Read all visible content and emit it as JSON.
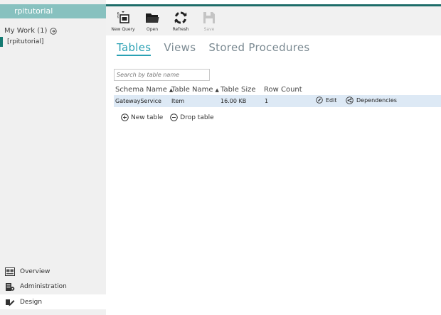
{
  "sidebar": {
    "header": "rpitutorial",
    "my_work_label": "My Work (1)",
    "workspace_item": "[rpitutorial]",
    "nav": [
      {
        "label": "Overview",
        "icon": "overview-icon"
      },
      {
        "label": "Administration",
        "icon": "administration-icon"
      },
      {
        "label": "Design",
        "icon": "design-icon"
      }
    ]
  },
  "toolbar": {
    "new_query": "New Query",
    "open": "Open",
    "refresh": "Refresh",
    "save": "Save"
  },
  "tabs": [
    "Tables",
    "Views",
    "Stored Procedures"
  ],
  "search": {
    "placeholder": "Search by table name"
  },
  "table": {
    "columns": [
      "Schema Name",
      "Table Name",
      "Table Size",
      "Row Count"
    ],
    "rows": [
      {
        "schema": "GatewayService",
        "table": "Item",
        "size": "16.00 KB",
        "count": "1",
        "edit": "Edit",
        "deps": "Dependencies"
      }
    ]
  },
  "actions": {
    "new_table": "New table",
    "drop_table": "Drop table"
  },
  "colors": {
    "accent": "#2aa1b4",
    "sidebar_header": "#87c1bf",
    "dark_teal": "#1d6d69",
    "row_highlight": "#dde9f5"
  }
}
